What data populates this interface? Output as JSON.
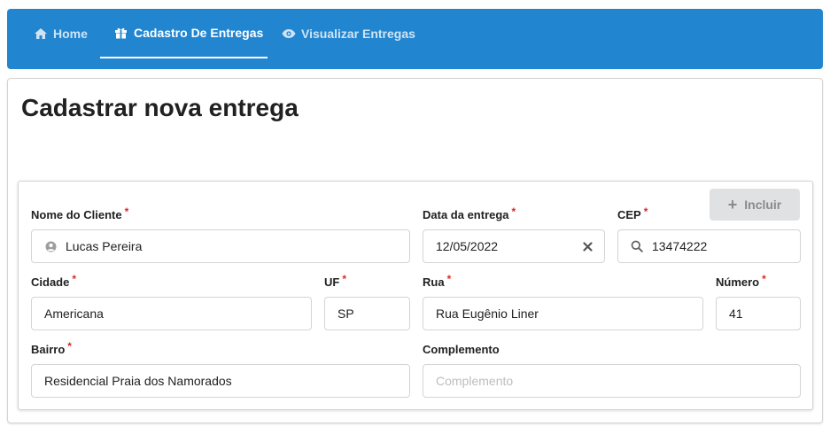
{
  "nav": {
    "home": "Home",
    "cadastro": "Cadastro De Entregas",
    "visualizar": "Visualizar Entregas"
  },
  "page": {
    "title": "Cadastrar nova entrega"
  },
  "form": {
    "add_button": "Incluir",
    "required_mark": "*",
    "nome": {
      "label": "Nome do Cliente",
      "value": "Lucas Pereira"
    },
    "data": {
      "label": "Data da entrega",
      "value": "12/05/2022"
    },
    "cep": {
      "label": "CEP",
      "value": "13474222"
    },
    "cidade": {
      "label": "Cidade",
      "value": "Americana"
    },
    "uf": {
      "label": "UF",
      "value": "SP"
    },
    "rua": {
      "label": "Rua",
      "value": "Rua Eugênio Liner"
    },
    "numero": {
      "label": "Número",
      "value": "41"
    },
    "bairro": {
      "label": "Bairro",
      "value": "Residencial Praia dos Namorados"
    },
    "complemento": {
      "label": "Complemento",
      "placeholder": "Complemento"
    }
  },
  "colors": {
    "primary": "#2185d0",
    "required": "#db2828"
  }
}
